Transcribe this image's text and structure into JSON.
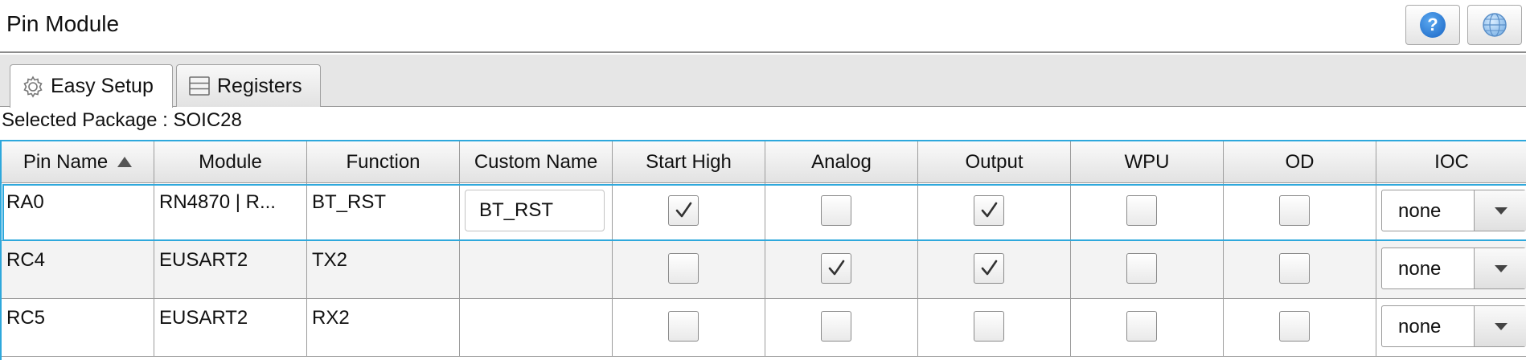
{
  "window": {
    "title": "Pin Module",
    "help_icon": "question-mark-icon",
    "globe_icon": "globe-icon"
  },
  "tabs": [
    {
      "label": "Easy Setup",
      "icon": "gear-icon",
      "active": true
    },
    {
      "label": "Registers",
      "icon": "registers-icon",
      "active": false
    }
  ],
  "package_text": "Selected Package : SOIC28",
  "table": {
    "columns": [
      "Pin Name",
      "Module",
      "Function",
      "Custom Name",
      "Start High",
      "Analog",
      "Output",
      "WPU",
      "OD",
      "IOC"
    ],
    "sort_column": "Pin Name",
    "sort_direction": "ascending",
    "rows": [
      {
        "pin": "RA0",
        "module": "RN4870 | R...",
        "function": "BT_RST",
        "custom_name": "BT_RST",
        "start_high": true,
        "analog": false,
        "output": true,
        "wpu": false,
        "od": false,
        "ioc": "none",
        "selected": true
      },
      {
        "pin": "RC4",
        "module": "EUSART2",
        "function": "TX2",
        "custom_name": "",
        "start_high": false,
        "analog": true,
        "output": true,
        "wpu": false,
        "od": false,
        "ioc": "none",
        "selected": false
      },
      {
        "pin": "RC5",
        "module": "EUSART2",
        "function": "RX2",
        "custom_name": "",
        "start_high": false,
        "analog": false,
        "output": false,
        "wpu": false,
        "od": false,
        "ioc": "none",
        "selected": false
      }
    ]
  },
  "colors": {
    "selection_accent": "#2ea8dc",
    "help_blue": "#1864c4"
  }
}
